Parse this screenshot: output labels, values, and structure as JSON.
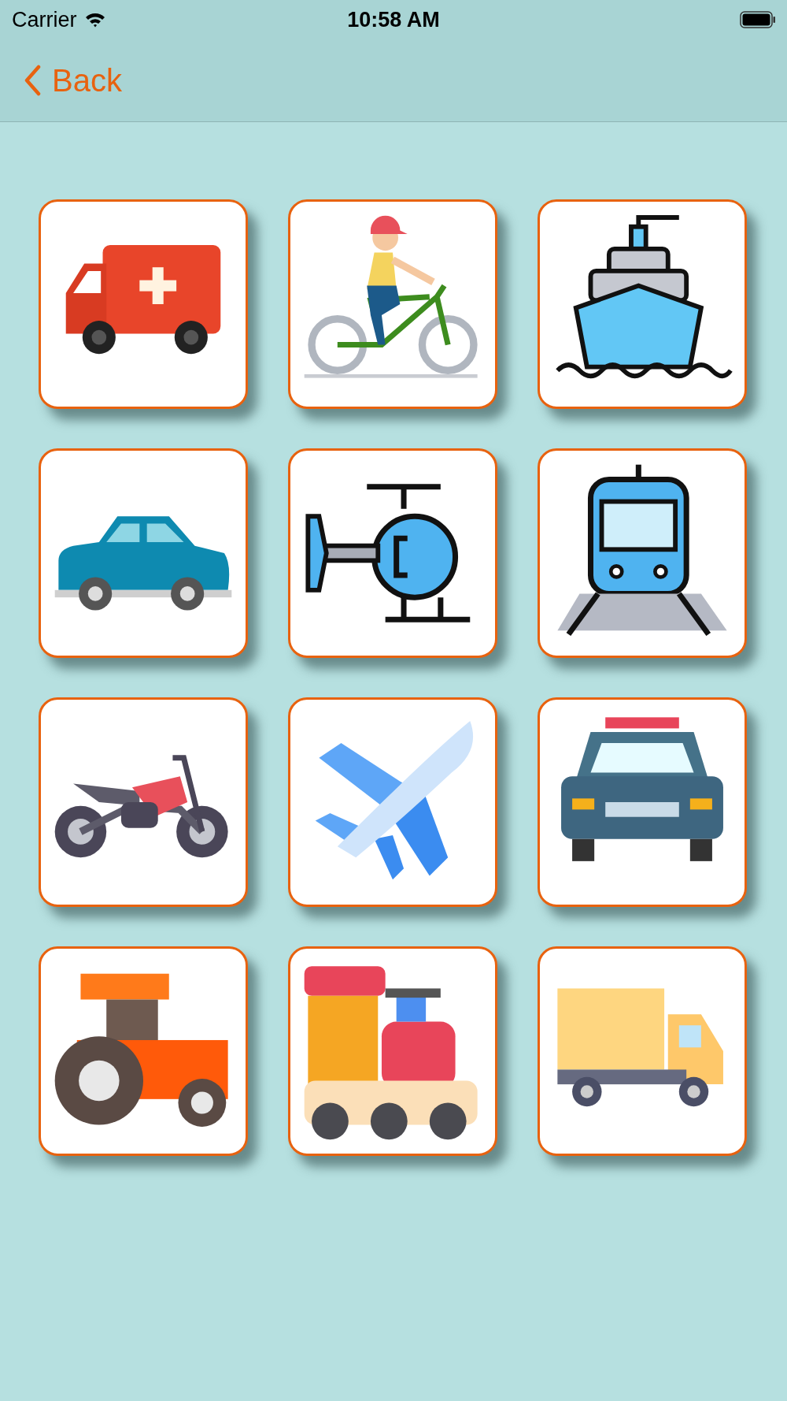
{
  "status_bar": {
    "carrier": "Carrier",
    "time": "10:58 AM"
  },
  "nav": {
    "back_label": "Back"
  },
  "tiles": [
    {
      "kind": "ambulance"
    },
    {
      "kind": "bicycle"
    },
    {
      "kind": "ship"
    },
    {
      "kind": "car"
    },
    {
      "kind": "helicopter"
    },
    {
      "kind": "tram"
    },
    {
      "kind": "motorcycle"
    },
    {
      "kind": "airplane"
    },
    {
      "kind": "police"
    },
    {
      "kind": "tractor"
    },
    {
      "kind": "locomotive"
    },
    {
      "kind": "truck"
    }
  ]
}
